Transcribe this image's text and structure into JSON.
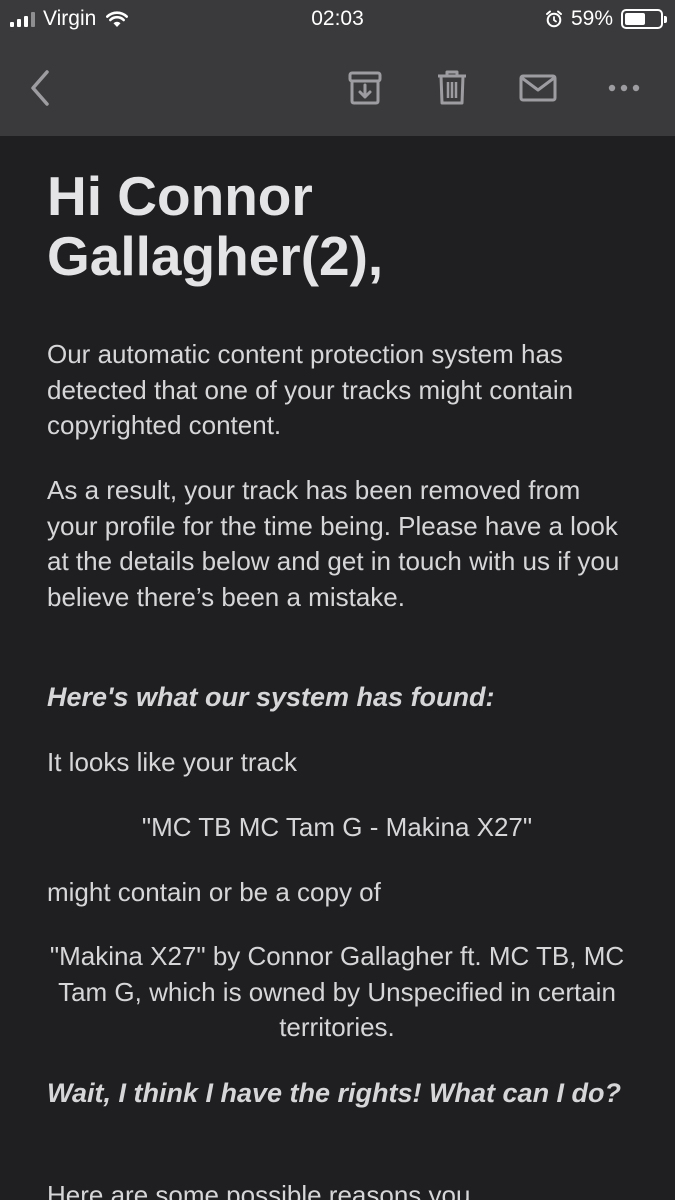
{
  "status_bar": {
    "carrier": "Virgin",
    "time": "02:03",
    "battery_percent": "59%",
    "battery_level": 0.59
  },
  "toolbar": {
    "icons": [
      "back-chevron-icon",
      "archive-icon",
      "trash-icon",
      "mail-icon",
      "more-icon"
    ]
  },
  "email": {
    "greeting": "Hi Connor Gallagher(2),",
    "para1": "Our automatic content protection system has detected that one of your tracks might contain copyrighted content.",
    "para2": "As a result, your track has been removed from your profile for the time being. Please have a look at the details below and get in touch with us if you believe there’s been a mistake.",
    "heading_found": "Here's what our system has found:",
    "track_intro": "It looks like your track",
    "track_name": "\"MC TB MC Tam G - Makina X27\"",
    "copy_intro": "might contain or be a copy of",
    "match_info": "\"Makina X27\" by Connor Gallagher ft. MC TB, MC Tam G, which is owned by Unspecified in certain territories.",
    "heading_rights": "Wait, I think I have the rights! What can I do?",
    "reasons_partial": "Here are some possible reasons you"
  },
  "colors": {
    "bar_background": "#3a3a3c",
    "page_background": "#1f1f21",
    "text": "#d6d6d8",
    "icon": "#9d9da1"
  }
}
